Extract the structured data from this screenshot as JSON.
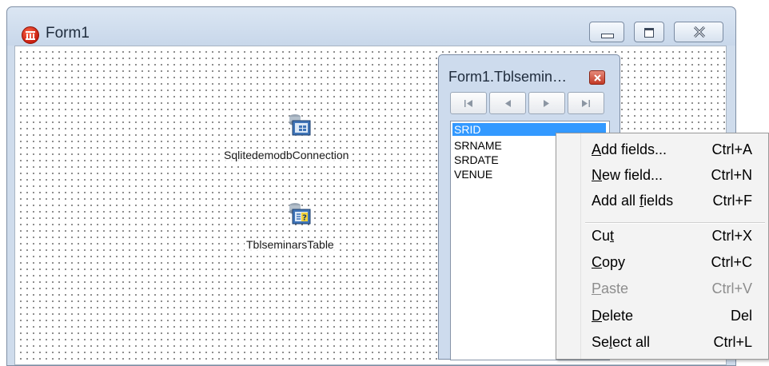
{
  "window": {
    "title": "Form1"
  },
  "components": [
    {
      "label": "SqlitedemodbConnection",
      "icon": "database-connection-icon"
    },
    {
      "label": "TblseminarsTable",
      "icon": "dataset-table-icon"
    }
  ],
  "fields_editor": {
    "title": "Form1.Tblsemin…",
    "nav_buttons": [
      "first-record",
      "prior-record",
      "next-record",
      "last-record"
    ],
    "fields": [
      "SRID",
      "SRNAME",
      "SRDATE",
      "VENUE"
    ],
    "selected_field": "SRID"
  },
  "context_menu": {
    "items": [
      {
        "pre": "",
        "accel": "A",
        "post": "dd fields...",
        "shortcut": "Ctrl+A",
        "enabled": true
      },
      {
        "pre": "",
        "accel": "N",
        "post": "ew field...",
        "shortcut": "Ctrl+N",
        "enabled": true
      },
      {
        "pre": "Add all ",
        "accel": "f",
        "post": "ields",
        "shortcut": "Ctrl+F",
        "enabled": true
      },
      {
        "pre": "Cu",
        "accel": "t",
        "post": "",
        "shortcut": "Ctrl+X",
        "enabled": true
      },
      {
        "pre": "",
        "accel": "C",
        "post": "opy",
        "shortcut": "Ctrl+C",
        "enabled": true
      },
      {
        "pre": "",
        "accel": "P",
        "post": "aste",
        "shortcut": "Ctrl+V",
        "enabled": false
      },
      {
        "pre": "",
        "accel": "D",
        "post": "elete",
        "shortcut": "Del",
        "enabled": true
      },
      {
        "pre": "Se",
        "accel": "l",
        "post": "ect all",
        "shortcut": "Ctrl+L",
        "enabled": true
      }
    ]
  }
}
